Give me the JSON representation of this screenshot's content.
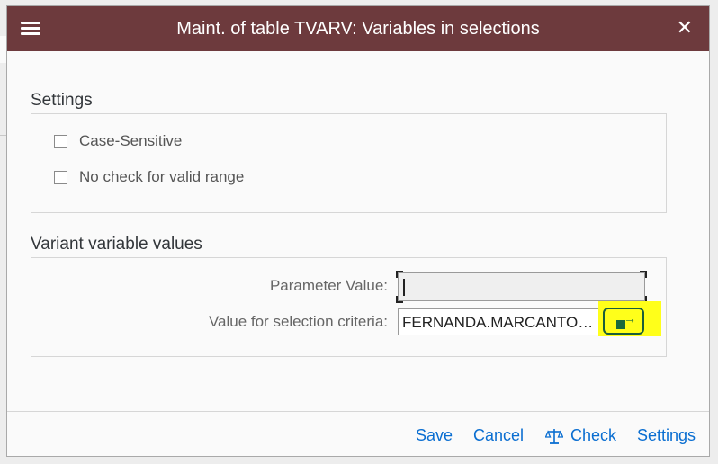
{
  "dialog": {
    "title": "Maint. of table TVARV: Variables in selections"
  },
  "settings": {
    "section_title": "Settings",
    "case_sensitive_label": "Case-Sensitive",
    "no_check_label": "No check for valid range"
  },
  "variant": {
    "section_title": "Variant variable values",
    "parameter_label": "Parameter Value:",
    "parameter_value": "",
    "selection_label": "Value for selection criteria:",
    "selection_value": "FERNANDA.MARCANTONI..."
  },
  "footer": {
    "save": "Save",
    "cancel": "Cancel",
    "check": "Check",
    "settings": "Settings"
  },
  "colors": {
    "titlebar": "#6d3a3d",
    "link": "#0a6ed1",
    "highlight": "#ffff1a"
  },
  "icons": {
    "menu": "hamburger-icon",
    "close": "close-icon",
    "multiple_selection": "multiple-selection-icon",
    "check": "scale-icon"
  }
}
